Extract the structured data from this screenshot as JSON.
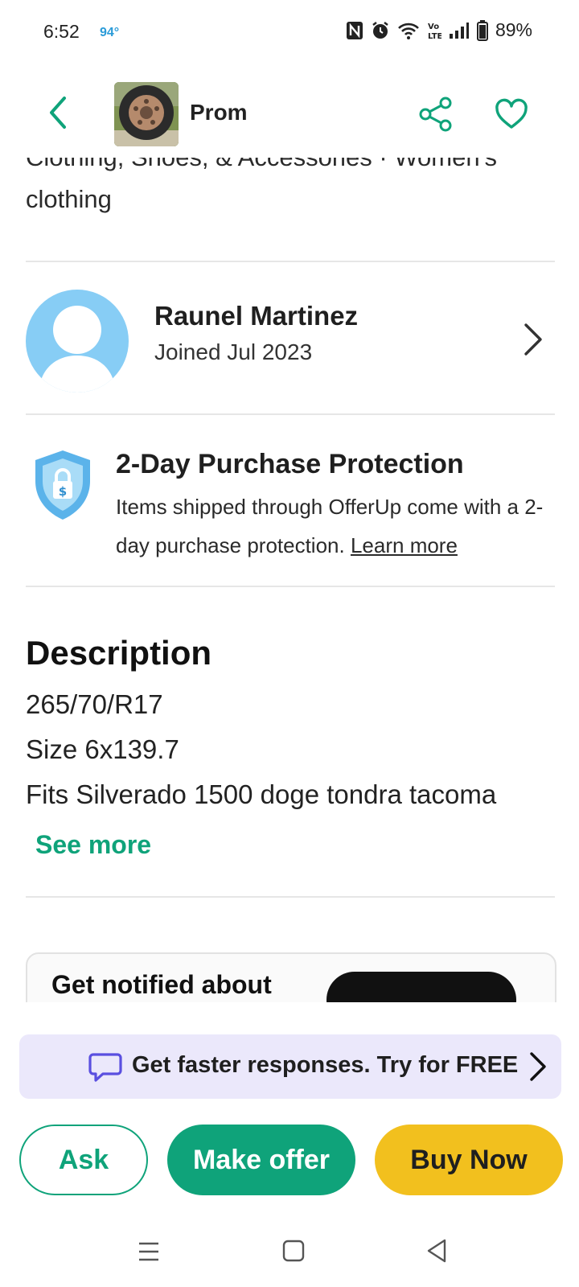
{
  "status_bar": {
    "time": "6:52",
    "temperature": "94°",
    "battery": "89%"
  },
  "header": {
    "title": "Prom"
  },
  "listing": {
    "category_path": "Clothing, Shoes, & Accessories · Women's clothing",
    "seller": {
      "name": "Raunel Martinez",
      "joined": "Joined Jul 2023"
    },
    "protection": {
      "title": "2-Day Purchase Protection",
      "body": "Items shipped through OfferUp come with a 2-day purchase protection.",
      "learn_more": "Learn more"
    },
    "description": {
      "title": "Description",
      "lines": [
        "265/70/R17",
        "Size 6x139.7",
        "Fits Silverado 1500  doge tondra  tacoma"
      ],
      "see_more": "See more"
    },
    "notify_text": "Get notified about"
  },
  "promo": {
    "text": "Get faster responses. Try for FREE"
  },
  "actions": {
    "ask": "Ask",
    "make_offer": "Make offer",
    "buy_now": "Buy Now"
  },
  "colors": {
    "accent_green": "#0fa37a",
    "buy_yellow": "#f2c01e",
    "promo_bg": "#ebe8fb",
    "avatar_blue": "#87cdf5"
  }
}
